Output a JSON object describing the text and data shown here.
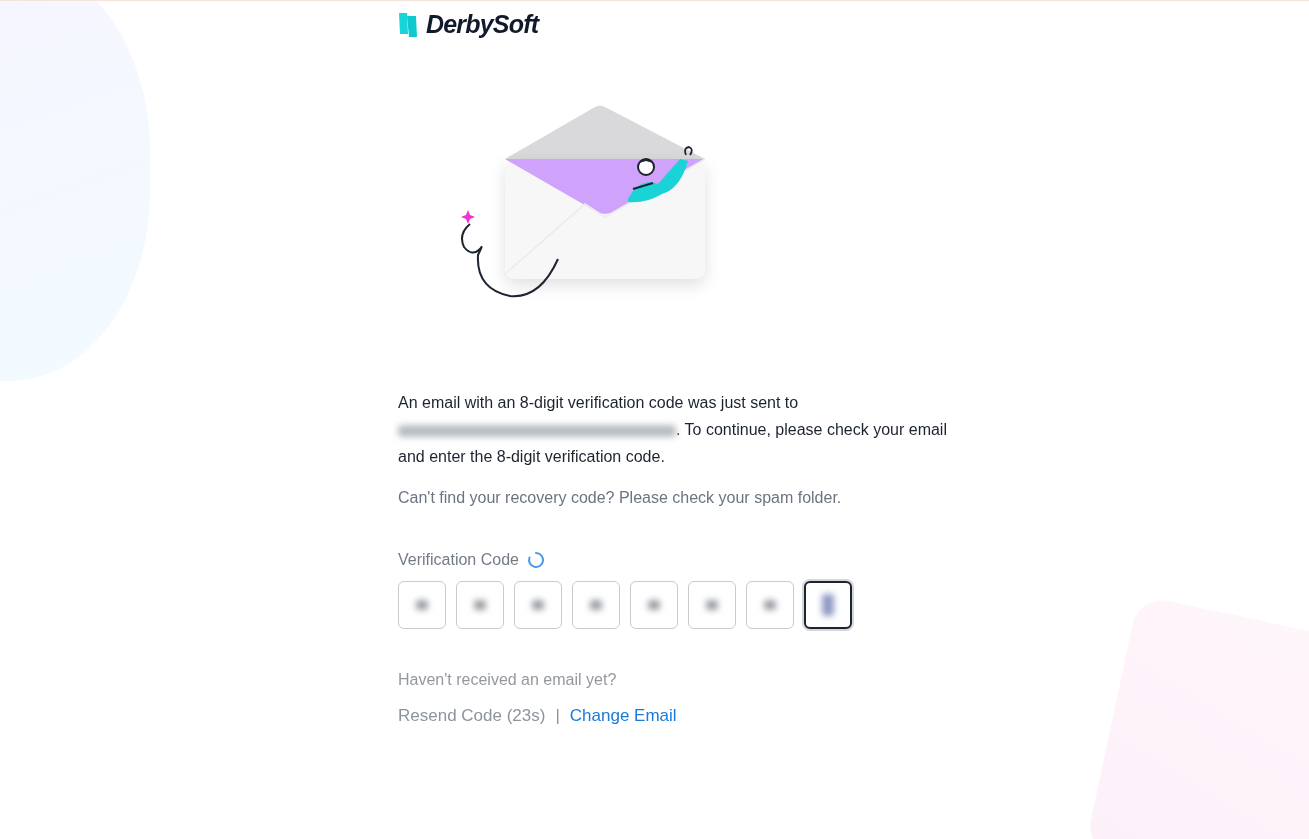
{
  "brand": {
    "name": "DerbySoft"
  },
  "message": {
    "before": "An email with an 8-digit verification code was just sent to",
    "email_redacted": true,
    "after": ". To continue, please check your email and enter the 8-digit verification code."
  },
  "hint": "Can't find your recovery code? Please check your spam folder.",
  "verification": {
    "label": "Verification Code",
    "loading": true,
    "fields": [
      {
        "focused": false
      },
      {
        "focused": false
      },
      {
        "focused": false
      },
      {
        "focused": false
      },
      {
        "focused": false
      },
      {
        "focused": false
      },
      {
        "focused": false
      },
      {
        "focused": true
      }
    ]
  },
  "footer": {
    "question": "Haven't received an email yet?",
    "resend": "Resend Code (23s)",
    "separator": "|",
    "change": "Change Email"
  }
}
